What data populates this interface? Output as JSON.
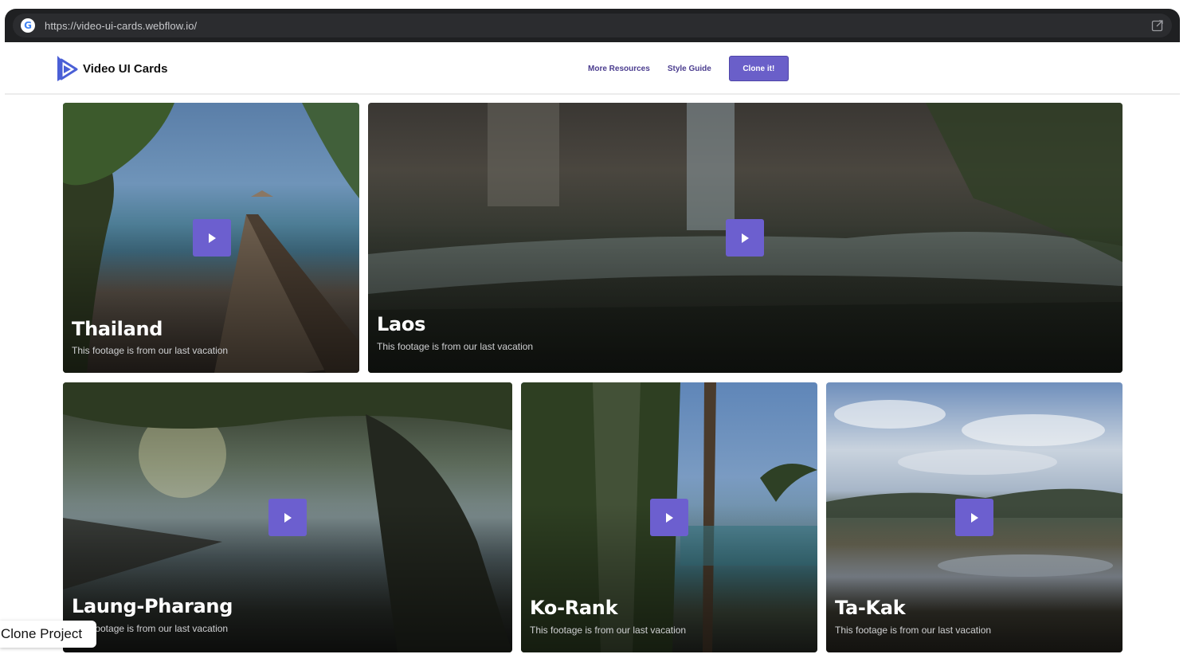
{
  "browser": {
    "url": "https://video-ui-cards.webflow.io/",
    "site_icon": "google-g-icon",
    "action_icon": "open-external-icon"
  },
  "nav": {
    "brand": "Video UI Cards",
    "logo_icon": "play-logo-icon",
    "links": [
      "More Resources",
      "Style Guide"
    ],
    "cta": "Clone it!"
  },
  "cards": [
    {
      "title": "Thailand",
      "subtitle": "This footage is from our last vacation"
    },
    {
      "title": "Laos",
      "subtitle": "This footage is from our last vacation"
    },
    {
      "title": "Laung-Pharang",
      "subtitle": "This footage is from our last vacation"
    },
    {
      "title": "Ko-Rank",
      "subtitle": "This footage is from our last vacation"
    },
    {
      "title": "Ta-Kak",
      "subtitle": "This footage is from our last vacation"
    }
  ],
  "floating": {
    "clone_project": "Clone Project"
  },
  "colors": {
    "accent": "#6a5fc9",
    "nav_link": "#4b3d8f"
  }
}
